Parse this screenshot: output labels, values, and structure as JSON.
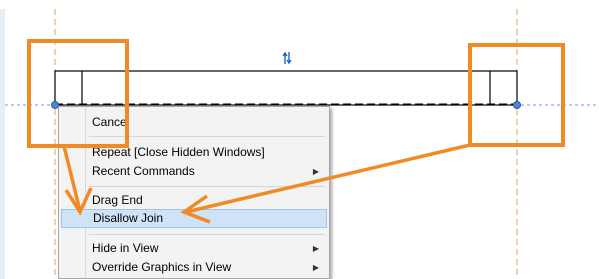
{
  "canvas": {
    "flip_icon": "flip-arrows-icon",
    "colors": {
      "background": "#ffffff",
      "wall_line": "#000000",
      "level_line": "#6a9be0",
      "grid_line": "#e0a050",
      "endpoint": "#4e86d6",
      "annotation": "#f08a24",
      "flip_icon": "#1f5fd6"
    }
  },
  "context_menu": {
    "items": [
      {
        "label": "Cance",
        "submenu": false
      },
      {
        "label": "Repeat [Close Hidden Windows]",
        "submenu": false
      },
      {
        "label": "Recent Commands",
        "submenu": true
      },
      {
        "label": "Drag End",
        "submenu": false
      },
      {
        "label": "Disallow Join",
        "submenu": false,
        "highlighted": true
      },
      {
        "label": "Hide in View",
        "submenu": true
      },
      {
        "label": "Override Graphics in View",
        "submenu": true
      }
    ],
    "colors": {
      "background": "#f3f3f3",
      "highlight": "#cfe2f6"
    }
  }
}
